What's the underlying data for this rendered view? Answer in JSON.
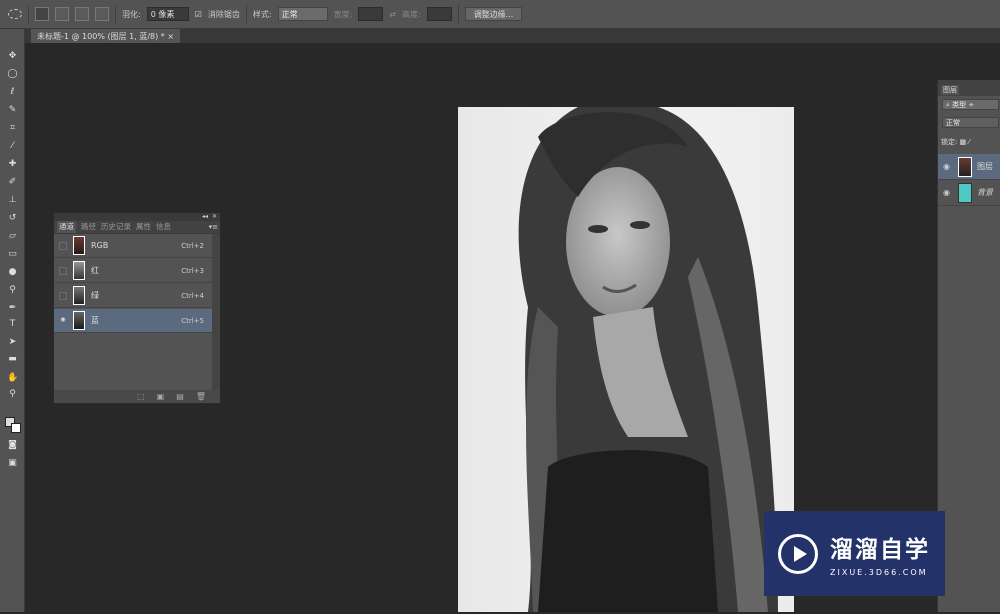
{
  "options_bar": {
    "feather_label": "羽化:",
    "feather_value": "0 像素",
    "antialias_label": "消除锯齿",
    "antialias_checked": true,
    "style_label": "样式:",
    "style_value": "正常",
    "width_label": "宽度:",
    "height_label": "高度:",
    "refine_edge_label": "调整边缘..."
  },
  "document_tab": {
    "title": "未标题-1 @ 100% (图层 1, 蓝/8) *",
    "close": "×"
  },
  "channels_panel": {
    "tabs": [
      "通道",
      "路径",
      "历史记录",
      "属性",
      "信息"
    ],
    "active_tab": "通道",
    "channels": [
      {
        "name": "RGB",
        "shortcut": "Ctrl+2",
        "visible": false,
        "selected": false
      },
      {
        "name": "红",
        "shortcut": "Ctrl+3",
        "visible": false,
        "selected": false
      },
      {
        "name": "绿",
        "shortcut": "Ctrl+4",
        "visible": false,
        "selected": false
      },
      {
        "name": "蓝",
        "shortcut": "Ctrl+5",
        "visible": true,
        "selected": true
      }
    ]
  },
  "layers_panel": {
    "title": "图层",
    "filter": "类型",
    "blend_mode": "正常",
    "lock_label": "锁定:",
    "layers": [
      {
        "name": "图层",
        "selected": true
      },
      {
        "name": "背景",
        "selected": false,
        "fill": "#4fc8c4"
      }
    ]
  },
  "watermark": {
    "brand": "溜溜自学",
    "url": "ZIXUE.3D66.COM",
    "bg": "#233268"
  }
}
